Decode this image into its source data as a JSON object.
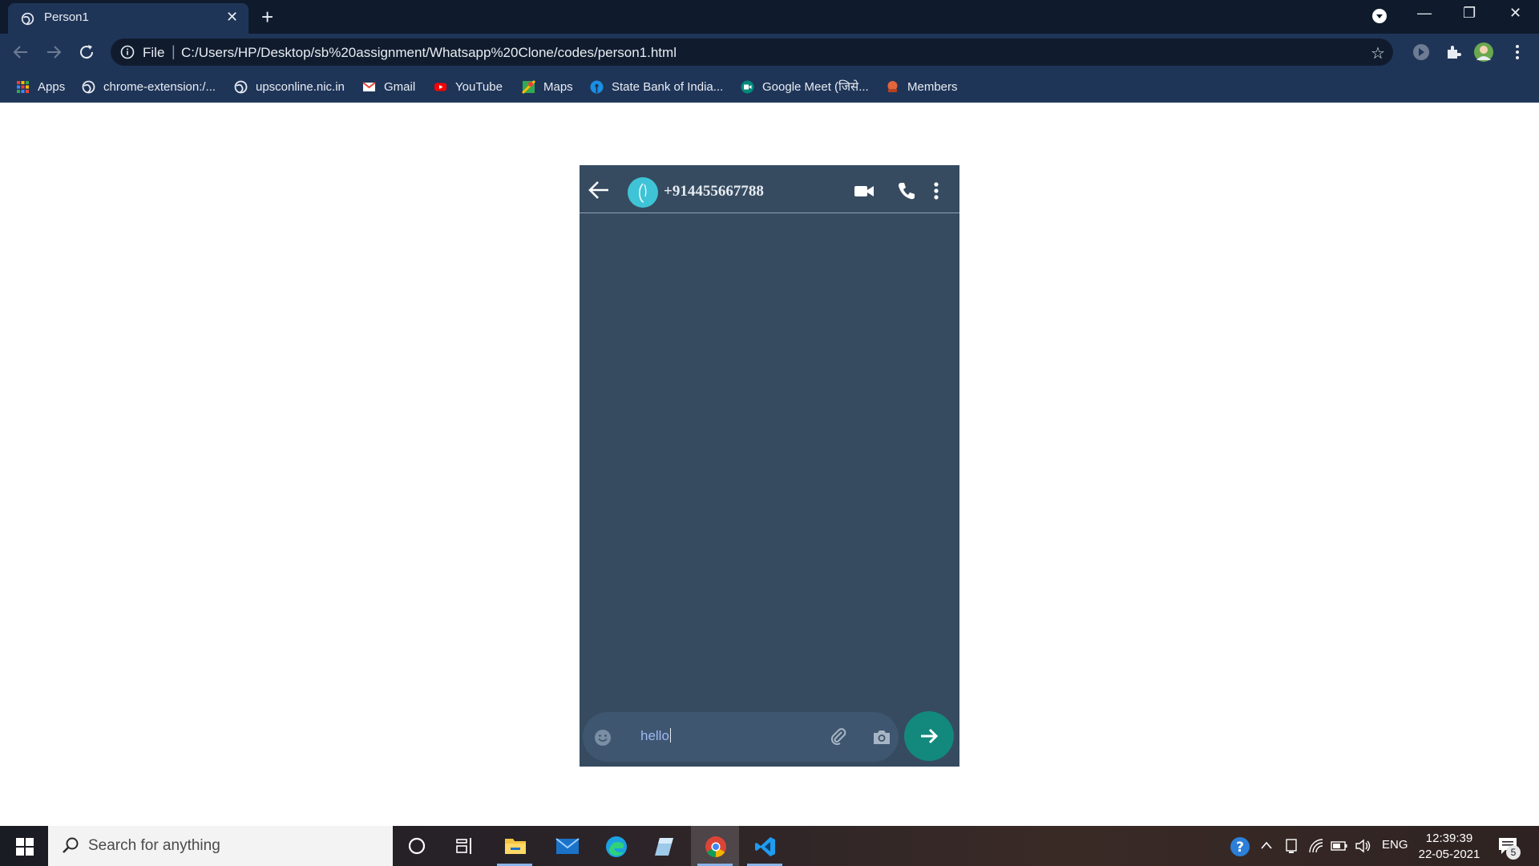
{
  "browser": {
    "tab_title": "Person1",
    "address_scheme": "File",
    "address_url": "C:/Users/HP/Desktop/sb%20assignment/Whatsapp%20Clone/codes/person1.html",
    "bookmarks": [
      {
        "label": "Apps",
        "icon": "apps-grid-icon"
      },
      {
        "label": "chrome-extension:/...",
        "icon": "globe-icon"
      },
      {
        "label": "upsconline.nic.in",
        "icon": "globe-icon"
      },
      {
        "label": "Gmail",
        "icon": "gmail-icon"
      },
      {
        "label": "YouTube",
        "icon": "youtube-icon"
      },
      {
        "label": "Maps",
        "icon": "maps-icon"
      },
      {
        "label": "State Bank of India...",
        "icon": "sbi-icon"
      },
      {
        "label": "Google Meet (जिसे...",
        "icon": "meet-icon"
      },
      {
        "label": "Members",
        "icon": "members-icon"
      }
    ]
  },
  "chat": {
    "contact_name": "+914455667788",
    "message_input_value": "hello",
    "colors": {
      "background": "#364b60",
      "send_button": "#12897c",
      "avatar": "#3ec4d6"
    }
  },
  "taskbar": {
    "search_placeholder": "Search for anything",
    "language": "ENG",
    "time": "12:39:39",
    "date": "22-05-2021",
    "notification_count": "5"
  }
}
